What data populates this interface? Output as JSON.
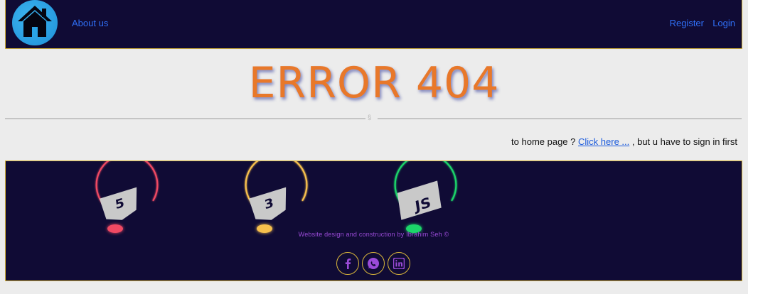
{
  "nav": {
    "logo_icon": "home-icon",
    "about": "About us",
    "register": "Register",
    "login": "Login"
  },
  "main": {
    "error_title": "ERROR 404",
    "divider_mark": "§",
    "home_prefix": "to home page ? ",
    "home_link": "Click here ...",
    "home_suffix": " , but u have to sign in first"
  },
  "footer": {
    "badges": [
      {
        "icon": "html5-icon",
        "color": "#f04a63"
      },
      {
        "icon": "css3-icon",
        "color": "#f7c04e"
      },
      {
        "icon": "js-icon",
        "color": "#1ed66a",
        "text": "JS"
      }
    ],
    "credit": "Website design and construction by Ibrahim Seh ©",
    "social": [
      {
        "icon": "facebook-icon"
      },
      {
        "icon": "whatsapp-icon"
      },
      {
        "icon": "linkedin-icon"
      }
    ]
  },
  "colors": {
    "nav_bg": "#100b35",
    "border": "#d9b63a",
    "error_title": "#e8782a",
    "link": "#2f6ff5",
    "footer_text": "#9b4bd8"
  }
}
